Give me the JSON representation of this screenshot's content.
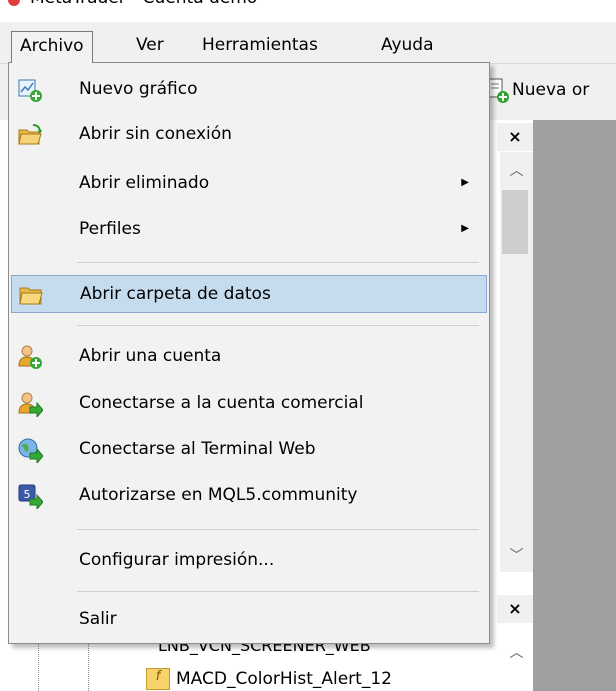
{
  "window": {
    "title": "MetaTrader - Cuenta demo"
  },
  "menubar": {
    "items": [
      "Archivo",
      "Ver",
      "Herramientas",
      "Ayuda"
    ]
  },
  "toolbar": {
    "new_order_label": "Nueva or"
  },
  "file_menu": {
    "new_chart": "Nuevo gráfico",
    "open_offline": "Abrir sin conexión",
    "open_deleted": "Abrir eliminado",
    "profiles": "Perfiles",
    "open_data_folder": "Abrir carpeta de datos",
    "open_account": "Abrir una cuenta",
    "connect_trade_account": "Conectarse a la cuenta comercial",
    "connect_web_terminal": "Conectarse al Terminal Web",
    "authorize_mql5": "Autorizarse en MQL5.community",
    "print_setup": "Configurar impresión...",
    "exit": "Salir"
  },
  "navigator": {
    "items": [
      "LNB_VCN_SCREENER_WEB",
      "MACD_ColorHist_Alert_12"
    ]
  },
  "colors": {
    "highlight": "#c5dcef",
    "highlight_border": "#88a9cc",
    "chart_bg": "#a0a0a0"
  }
}
